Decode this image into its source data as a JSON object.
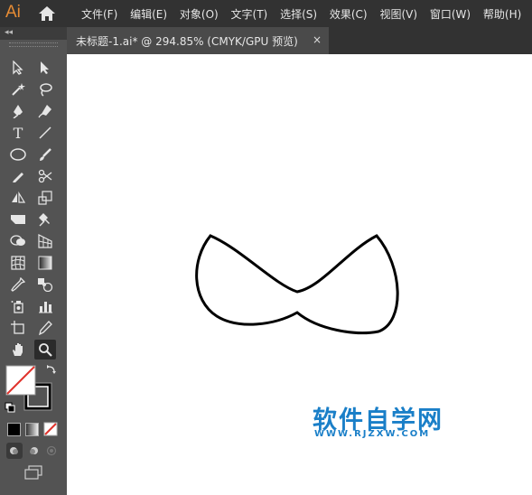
{
  "app": {
    "logo": "Ai"
  },
  "menu": [
    "文件(F)",
    "编辑(E)",
    "对象(O)",
    "文字(T)",
    "选择(S)",
    "效果(C)",
    "视图(V)",
    "窗口(W)",
    "帮助(H)"
  ],
  "panel": {
    "collapse_glyph": "◂◂"
  },
  "tab": {
    "title": "未标题-1.ai* @ 294.85% (CMYK/GPU 预览)",
    "close": "×"
  },
  "tools": [
    "selection-tool",
    "direct-selection-tool",
    "magic-wand-tool",
    "lasso-tool",
    "pen-tool",
    "curvature-tool",
    "type-tool",
    "line-segment-tool",
    "ellipse-tool",
    "paintbrush-tool",
    "pencil-tool",
    "scissors-tool",
    "reflect-tool",
    "scale-tool",
    "width-tool",
    "puppet-warp-tool",
    "shape-builder-tool",
    "perspective-grid-tool",
    "mesh-tool",
    "gradient-tool",
    "eyedropper-tool",
    "blend-tool",
    "symbol-sprayer-tool",
    "column-graph-tool",
    "artboard-tool",
    "slice-tool",
    "hand-tool",
    "zoom-tool"
  ],
  "colors": {
    "fill": "#ffffff",
    "stroke": "#000000",
    "accent": "#1a7fc8",
    "logo": "#e58b34"
  },
  "watermark": {
    "main": "软件自学网",
    "sub": "WWW.RJZXW.COM"
  }
}
